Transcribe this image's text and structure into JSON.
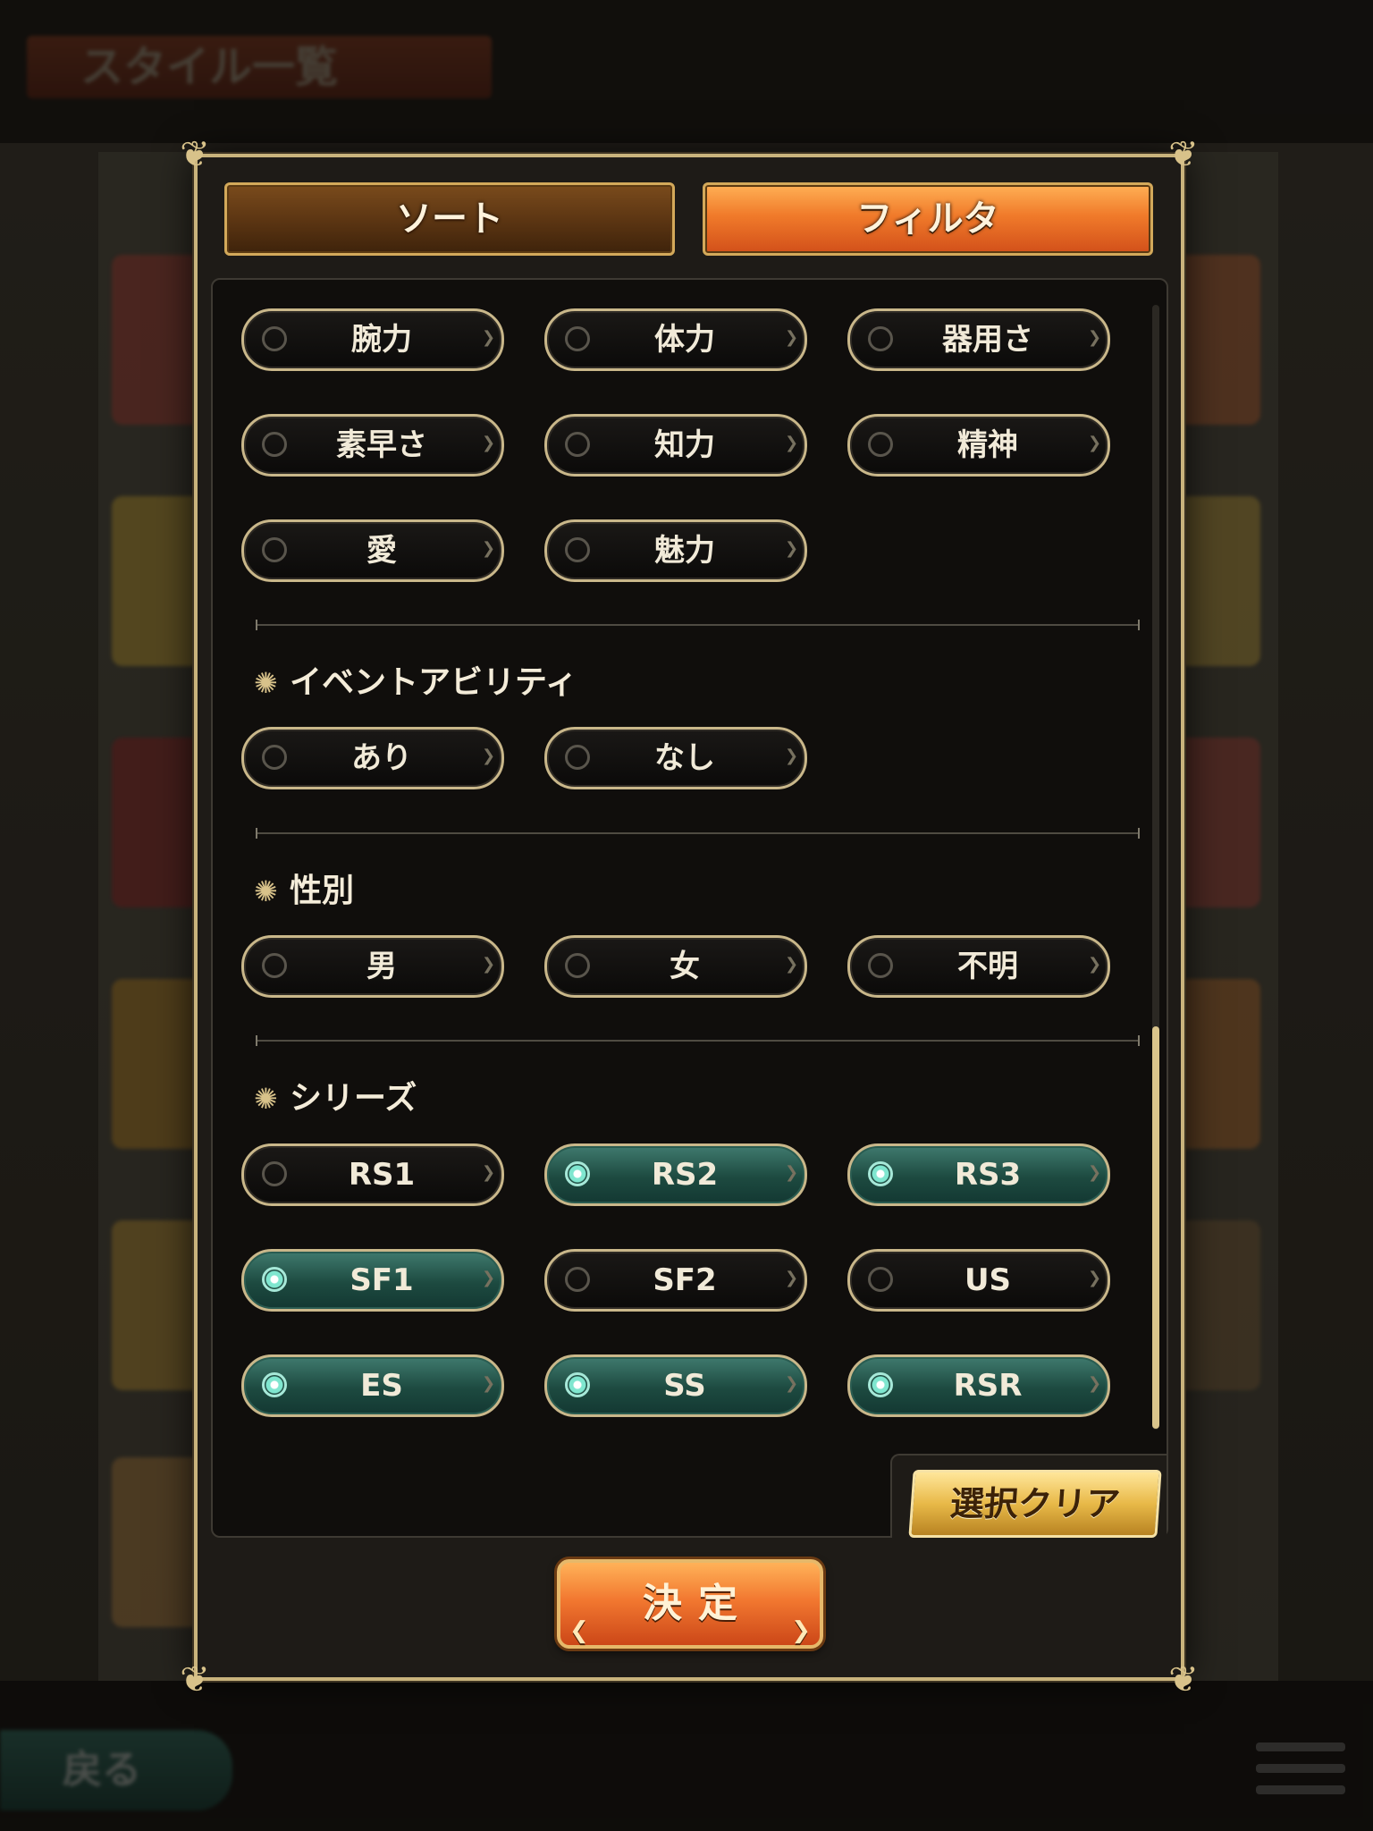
{
  "background": {
    "title": "スタイル一覧",
    "back_label": "戻る"
  },
  "tabs": {
    "sort": "ソート",
    "filter": "フィルタ"
  },
  "filters": {
    "stats": [
      "腕力",
      "体力",
      "器用さ",
      "素早さ",
      "知力",
      "精神",
      "愛",
      "魅力"
    ],
    "event_ability": {
      "title": "イベントアビリティ",
      "options": [
        "あり",
        "なし"
      ]
    },
    "gender": {
      "title": "性別",
      "options": [
        "男",
        "女",
        "不明"
      ]
    },
    "series": {
      "title": "シリーズ",
      "options": [
        "RS1",
        "RS2",
        "RS3",
        "SF1",
        "SF2",
        "US",
        "ES",
        "SS",
        "RSR"
      ],
      "selected": {
        "RS1": false,
        "RS2": true,
        "RS3": true,
        "SF1": true,
        "SF2": false,
        "US": false,
        "ES": true,
        "SS": true,
        "RSR": true
      }
    }
  },
  "buttons": {
    "clear": "選択クリア",
    "confirm": "決定"
  },
  "colors": {
    "selected_option": "#1d4a40",
    "active_tab": "#f07a2a",
    "panel_border": "#c9b37c"
  }
}
